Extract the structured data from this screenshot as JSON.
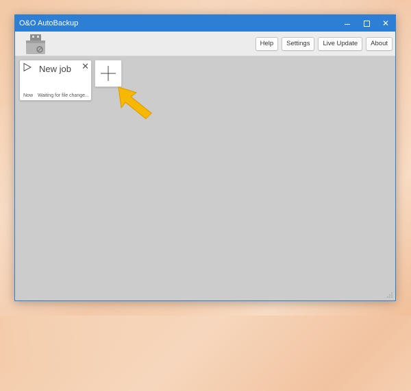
{
  "window": {
    "title": "O&O AutoBackup",
    "controls": {
      "minimize": "minimize",
      "maximize": "maximize",
      "close": "✕"
    }
  },
  "toolbar": {
    "buttons": [
      "Help",
      "Settings",
      "Live Update",
      "About"
    ]
  },
  "jobs": [
    {
      "title": "New job",
      "time": "Now",
      "status": "Waiting for file change..."
    }
  ],
  "colors": {
    "titlebar": "#2d7fd6",
    "arrow": "#f6b800",
    "workspace": "#cccccc"
  }
}
